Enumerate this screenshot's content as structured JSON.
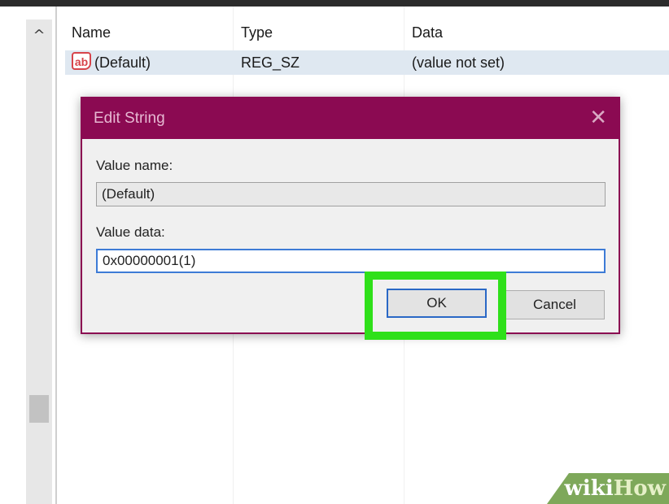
{
  "list": {
    "columns": [
      "Name",
      "Type",
      "Data"
    ],
    "rows": [
      {
        "icon": "ab",
        "name": "(Default)",
        "type": "REG_SZ",
        "data": "(value not set)"
      }
    ]
  },
  "dialog": {
    "title": "Edit String",
    "close_glyph": "✕",
    "value_name_label": "Value name:",
    "value_name": "(Default)",
    "value_data_label": "Value data:",
    "value_data": "0x00000001(1)",
    "ok_label": "OK",
    "cancel_label": "Cancel"
  },
  "scroll_up_glyph": "^",
  "watermark": {
    "part1": "wiki",
    "part2": "How"
  },
  "colors": {
    "dialog_title_bar": "#8b0a52",
    "highlight": "#2fe01a",
    "selected_row": "#dfe8f1"
  }
}
